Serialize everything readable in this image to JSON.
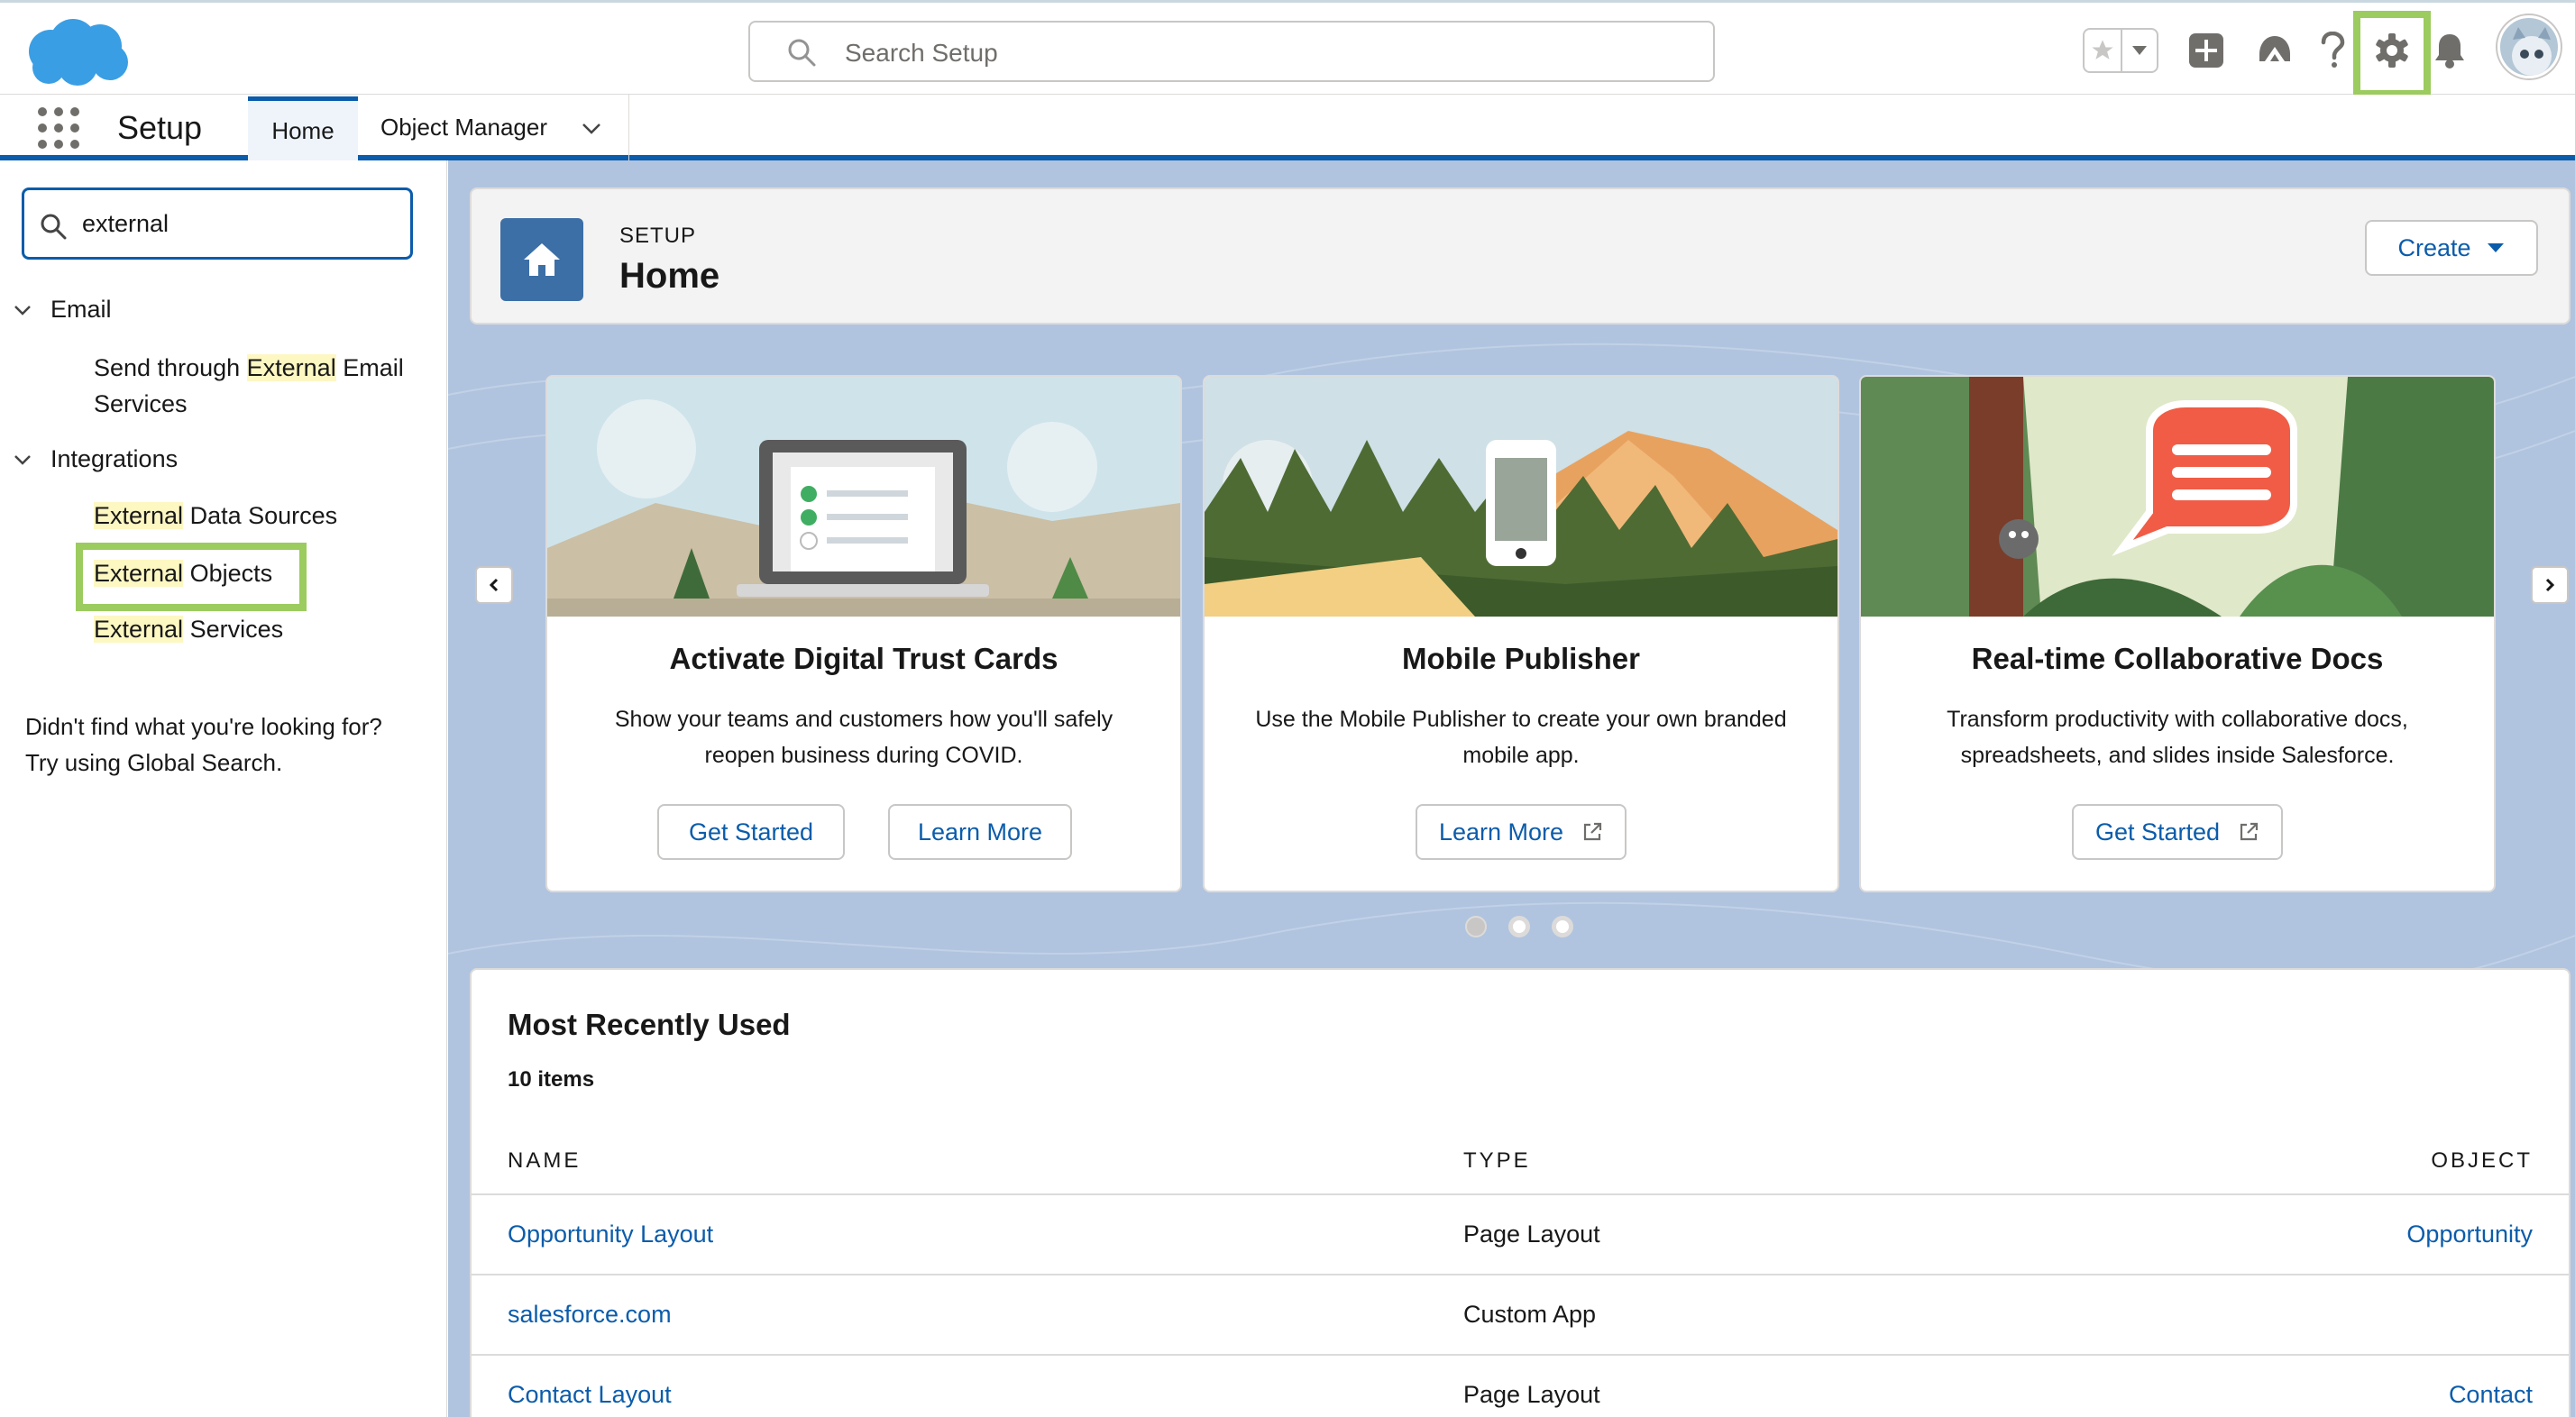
{
  "header": {
    "search_placeholder": "Search Setup",
    "icons": [
      "cloud-logo",
      "search-icon",
      "favorites-star-icon",
      "favorites-dropdown-icon",
      "add-icon",
      "trailhead-icon",
      "help-icon",
      "gear-icon",
      "bell-icon",
      "avatar"
    ],
    "highlight_color": "#9ccb5f"
  },
  "context_bar": {
    "app_name": "Setup",
    "tabs": [
      {
        "label": "Home",
        "active": true
      },
      {
        "label": "Object Manager",
        "active": false
      }
    ]
  },
  "sidebar": {
    "quick_find_value": "external",
    "groups": [
      {
        "label": "Email",
        "items": [
          {
            "pre": "Send through ",
            "match": "External",
            "post": " Email Services"
          }
        ]
      },
      {
        "label": "Integrations",
        "items": [
          {
            "match": "External",
            "post": " Data Sources"
          },
          {
            "match": "External",
            "post": " Objects"
          },
          {
            "match": "External",
            "post": " Services"
          }
        ]
      }
    ],
    "not_found_line1": "Didn't find what you're looking for?",
    "not_found_line2": "Try using Global Search."
  },
  "page_header": {
    "eyebrow": "SETUP",
    "title": "Home",
    "create_label": "Create"
  },
  "cards": [
    {
      "title": "Activate Digital Trust Cards",
      "desc_line1": "Show your teams and customers how you'll safely",
      "desc_line2": "reopen business during COVID.",
      "buttons": [
        "Get Started",
        "Learn More"
      ]
    },
    {
      "title": "Mobile Publisher",
      "desc_line1": "Use the Mobile Publisher to create your own branded",
      "desc_line2": "mobile app.",
      "buttons": [
        "Learn More"
      ]
    },
    {
      "title": "Real-time Collaborative Docs",
      "desc_line1": "Transform productivity with collaborative docs,",
      "desc_line2": "spreadsheets, and slides inside Salesforce.",
      "buttons": [
        "Get Started"
      ]
    }
  ],
  "carousel": {
    "pages": 3,
    "active_page": 1
  },
  "mru": {
    "title": "Most Recently Used",
    "count": "10 items",
    "columns": [
      "NAME",
      "TYPE",
      "OBJECT"
    ],
    "rows": [
      {
        "name": "Opportunity Layout",
        "type": "Page Layout",
        "object": "Opportunity"
      },
      {
        "name": "salesforce.com",
        "type": "Custom App",
        "object": ""
      },
      {
        "name": "Contact Layout",
        "type": "Page Layout",
        "object": "Contact"
      }
    ]
  }
}
